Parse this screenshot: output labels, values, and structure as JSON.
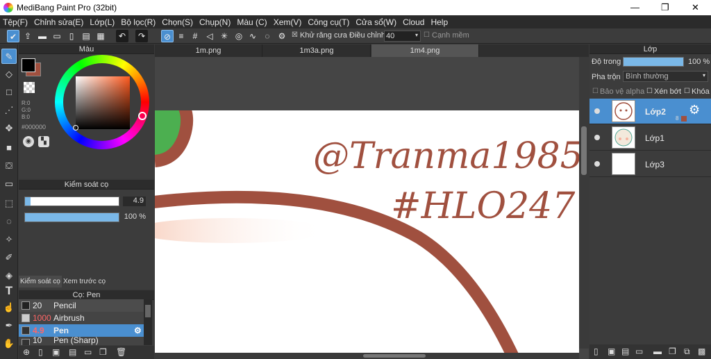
{
  "window": {
    "title": "MediBang Paint Pro (32bit)",
    "minimize": "—",
    "maximize": "❐",
    "close": "✕"
  },
  "menu": [
    "Tệp(F)",
    "Chỉnh sửa(E)",
    "Lớp(L)",
    "Bộ lọc(R)",
    "Chọn(S)",
    "Chụp(N)",
    "Màu (C)",
    "Xem(V)",
    "Công cụ(T)",
    "Cửa sổ(W)",
    "Cloud",
    "Help"
  ],
  "toolbar": {
    "antialias_check": "☒",
    "antialias_label": "Khử răng cưa",
    "adjust_label": "Điều chỉnh",
    "adjust_value": "40",
    "edge_check": "☐",
    "edge_label": "Cạnh mềm"
  },
  "color_panel": {
    "title": "Màu",
    "r": "R:0",
    "g": "G:0",
    "b": "B:0",
    "hex": "#000000",
    "fg": "#000000",
    "bg": "#a0503f"
  },
  "brush_control": {
    "title": "Kiểm soát cọ",
    "size_value": "4.9",
    "size_fill": 0.06,
    "opacity_value": "100 %",
    "opacity_fill": 1.0,
    "tab1": "Kiểm soát cọ",
    "tab2": "Xem trước cọ"
  },
  "brush_panel": {
    "title": "Cọ: Pen",
    "items": [
      {
        "size": "20",
        "name": "Pencil"
      },
      {
        "size": "1000",
        "name": "Airbrush"
      },
      {
        "size": "4.9",
        "name": "Pen"
      },
      {
        "size": "10",
        "name": "Pen (Sharp)"
      }
    ]
  },
  "tabs": [
    "1m.png",
    "1m3a.png",
    "1m4.png"
  ],
  "canvas": {
    "text1": "@Tranma1985",
    "text2": "#HLO247",
    "stroke_color": "#a0503f"
  },
  "layer_panel": {
    "title": "Lớp",
    "opacity_label": "Độ trong",
    "opacity_value": "100 %",
    "opacity_fill": 1.0,
    "blend_label": "Pha trộn",
    "blend_value": "Bình thường",
    "protect_alpha": "Bảo vệ alpha",
    "clip": "Xén bớt",
    "lock": "Khóa",
    "layer_badge": "8",
    "layers": [
      "Lớp2",
      "Lớp1",
      "Lớp3"
    ]
  }
}
